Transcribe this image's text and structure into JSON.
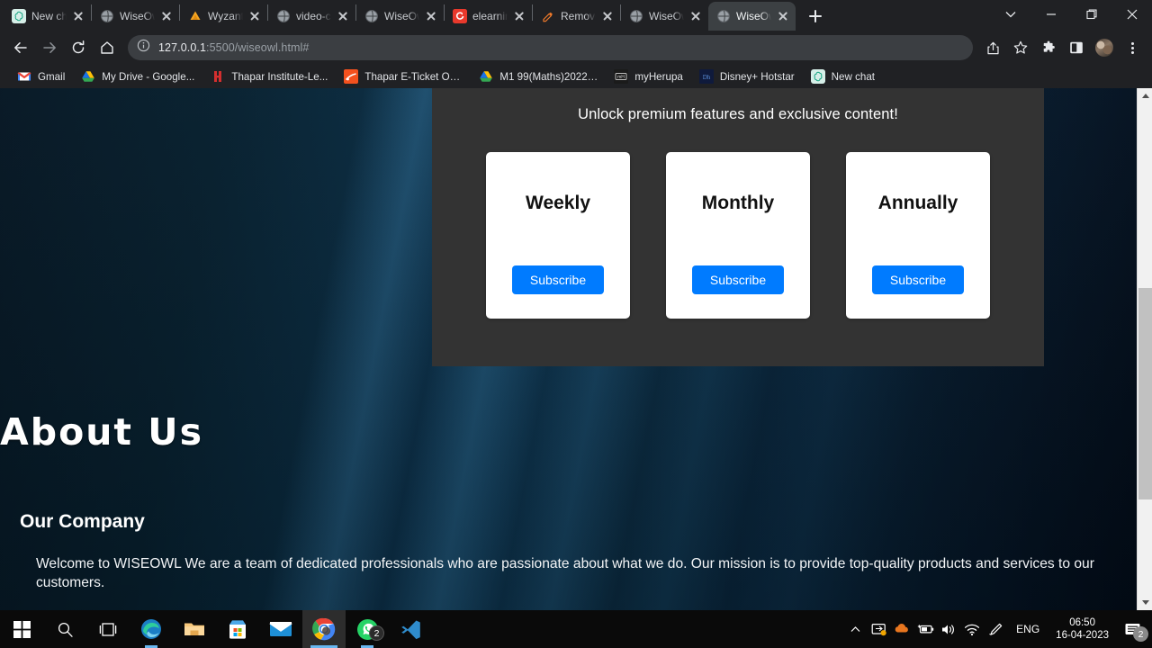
{
  "browser": {
    "tabs": [
      {
        "title": "New chat",
        "favicon": "chatgpt-icon",
        "active": false
      },
      {
        "title": "WiseOwl",
        "favicon": "globe-icon",
        "active": false
      },
      {
        "title": "Wyzant: F",
        "favicon": "wyzant-icon",
        "active": false
      },
      {
        "title": "video-ch",
        "favicon": "globe-icon",
        "active": false
      },
      {
        "title": "WiseOwl",
        "favicon": "globe-icon",
        "active": false
      },
      {
        "title": "elearning",
        "favicon": "elearning-icon",
        "active": false
      },
      {
        "title": "Remove ",
        "favicon": "removebg-icon",
        "active": false
      },
      {
        "title": "WiseOwl",
        "favicon": "globe-icon",
        "active": false
      },
      {
        "title": "WiseOwl",
        "favicon": "globe-icon",
        "active": true
      }
    ],
    "new_tab_label": "New tab",
    "window_controls": {
      "tab_search": "Search tabs",
      "minimize": "Minimize",
      "maximize": "Restore",
      "close": "Close"
    },
    "toolbar": {
      "back": "Back",
      "forward": "Forward",
      "reload": "Reload",
      "home": "Home",
      "url_host": "127.0.0.1",
      "url_path": ":5500/wiseowl.html#",
      "share": "Share this page",
      "bookmark": "Bookmark this tab",
      "extensions": "Extensions",
      "side_panel": "Side panel",
      "profile": "Profile",
      "menu": "Customize and control Google Chrome"
    },
    "bookmarks": [
      {
        "label": "Gmail",
        "icon": "gmail-icon"
      },
      {
        "label": "My Drive - Google...",
        "icon": "google-drive-icon"
      },
      {
        "label": "Thapar Institute-Le...",
        "icon": "thapar-icon"
      },
      {
        "label": "Thapar E-Ticket Onl...",
        "icon": "eticket-icon"
      },
      {
        "label": "M1 99(Maths)2022-...",
        "icon": "google-drive-icon"
      },
      {
        "label": "myHerupa",
        "icon": "myherupa-icon"
      },
      {
        "label": "Disney+ Hotstar",
        "icon": "hotstar-icon"
      },
      {
        "label": "New chat",
        "icon": "chatgpt-icon"
      }
    ]
  },
  "page": {
    "pricing": {
      "subtitle": "Unlock premium features and exclusive content!",
      "plans": [
        {
          "name": "Weekly",
          "cta": "Subscribe"
        },
        {
          "name": "Monthly",
          "cta": "Subscribe"
        },
        {
          "name": "Annually",
          "cta": "Subscribe"
        }
      ],
      "accent_color": "#007bff",
      "panel_color": "#333333"
    },
    "about": {
      "heading": "About Us",
      "subheading": "Our Company",
      "body": "Welcome to WISEOWL We are a team of dedicated professionals who are passionate about what we do. Our mission is to provide top-quality products and services to our customers."
    }
  },
  "taskbar": {
    "items": [
      {
        "name": "start",
        "label": "Start"
      },
      {
        "name": "search",
        "label": "Search"
      },
      {
        "name": "task-view",
        "label": "Task View"
      },
      {
        "name": "edge",
        "label": "Microsoft Edge"
      },
      {
        "name": "file-explorer",
        "label": "File Explorer"
      },
      {
        "name": "microsoft-store",
        "label": "Microsoft Store"
      },
      {
        "name": "mail",
        "label": "Mail"
      },
      {
        "name": "chrome",
        "label": "Google Chrome"
      },
      {
        "name": "whatsapp",
        "label": "WhatsApp",
        "badge": "2"
      },
      {
        "name": "vscode",
        "label": "Visual Studio Code"
      }
    ],
    "tray": {
      "show_hidden": "Show hidden icons",
      "display": "Display settings",
      "cloud": "Cloud",
      "battery": "Battery charging",
      "volume": "Volume",
      "wifi": "Network",
      "pen": "Pen menu",
      "language": "ENG",
      "time": "06:50",
      "date": "16-04-2023",
      "notifications_badge": "2"
    }
  }
}
